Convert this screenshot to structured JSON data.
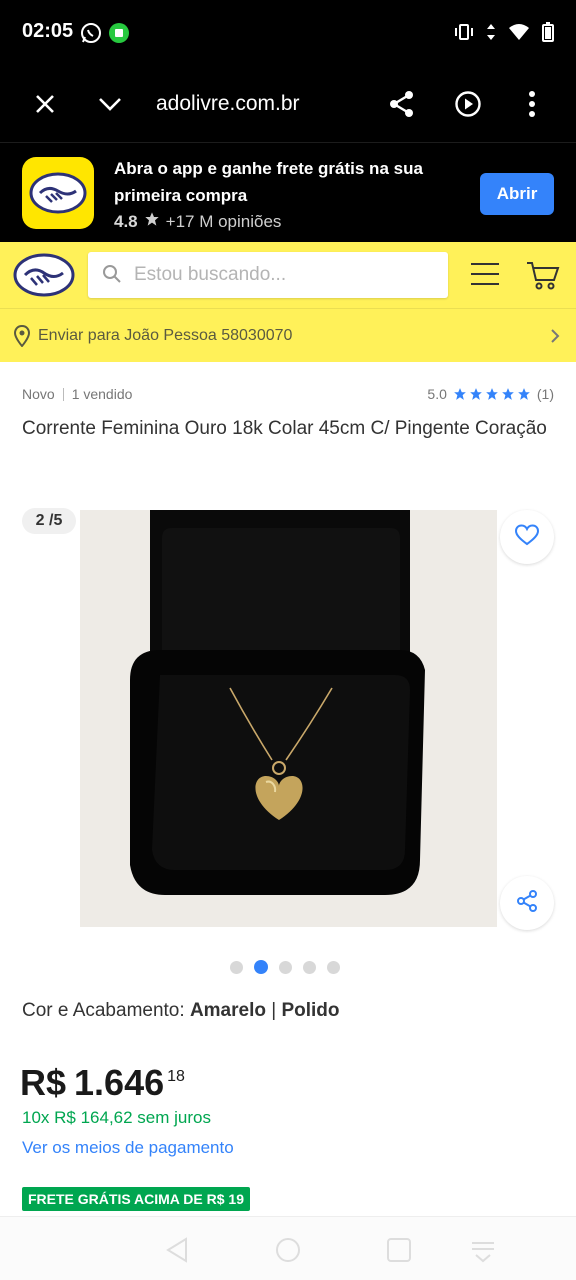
{
  "status_bar": {
    "time": "02:05",
    "left_icons": [
      "whatsapp-icon",
      "app-notification-icon"
    ],
    "right_icons": [
      "vibrate-icon",
      "data-arrows-icon",
      "wifi-icon",
      "battery-icon"
    ]
  },
  "browser": {
    "url": "adolivre.com.br",
    "buttons": [
      "close-icon",
      "chevron-down-icon",
      "share-icon",
      "play-icon",
      "more-icon"
    ]
  },
  "app_promo": {
    "title": "Abra o app e ganhe frete grátis na sua primeira compra",
    "rating": "4.8",
    "reviews": "+17 M opiniões",
    "open_button": "Abrir"
  },
  "header": {
    "search_placeholder": "Estou buscando...",
    "icons": [
      "menu-icon",
      "cart-icon"
    ]
  },
  "delivery": {
    "text": "Enviar para João Pessoa 58030070"
  },
  "product": {
    "condition": "Novo",
    "sold": "1 vendido",
    "rating": "5.0",
    "stars": 5,
    "review_count": "(1)",
    "title": "Corrente Feminina Ouro 18k Colar 45cm C/ Pingente Coração",
    "image_counter": "2 /5",
    "images_total": 5,
    "active_image": 2,
    "variation_label": "Cor e Acabamento: ",
    "variation_color": "Amarelo",
    "variation_separator": " | ",
    "variation_finish": "Polido",
    "price_currency": "R$",
    "price_main": "1.646",
    "price_cents": "18",
    "installments": "10x R$ 164,62 sem juros",
    "payment_link": "Ver os meios de pagamento",
    "shipping_badge": "FRETE GRÁTIS ACIMA DE R$ 19"
  },
  "colors": {
    "ml_yellow": "#fff159",
    "primary_blue": "#3483fa",
    "green": "#00a650",
    "status_black": "#000000"
  }
}
